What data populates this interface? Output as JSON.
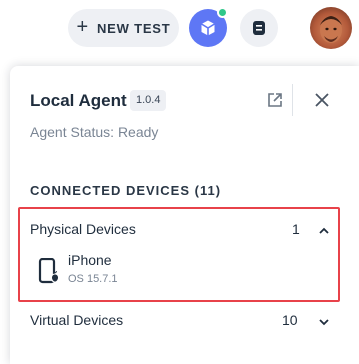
{
  "header": {
    "new_test_label": "NEW TEST",
    "new_test_icon": "plus-icon",
    "agent_icon": "cube-icon",
    "agent_status_color": "#2fc78a",
    "device_icon": "device-icon",
    "avatar_icon": "user-avatar"
  },
  "panel": {
    "title": "Local Agent",
    "version": "1.0.4",
    "status": "Agent Status: Ready",
    "connected_heading": "CONNECTED DEVICES (11)",
    "groups": [
      {
        "label": "Physical Devices",
        "count": "1",
        "expanded": true,
        "devices": [
          {
            "name": "iPhone",
            "os": "OS 15.7.1"
          }
        ]
      },
      {
        "label": "Virtual Devices",
        "count": "10",
        "expanded": false
      }
    ]
  },
  "colors": {
    "accent": "#5e77f5",
    "highlight_border": "#e8424a"
  }
}
